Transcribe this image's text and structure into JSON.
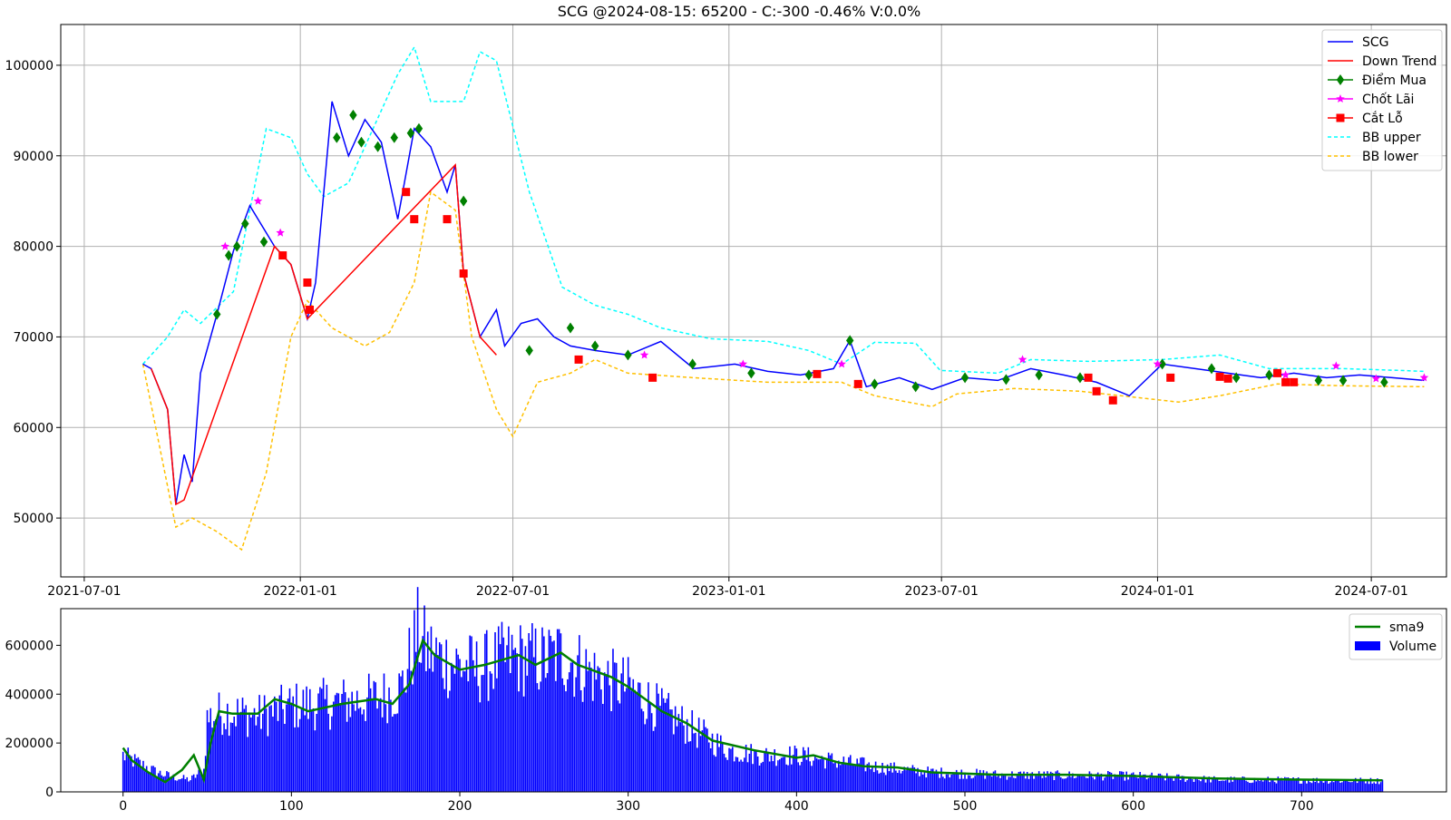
{
  "chart_data": [
    {
      "type": "line",
      "title": "SCG @2024-08-15: 65200 - C:-300 -0.46% V:0.0%",
      "xlabel": "",
      "ylabel": "",
      "x_tick_labels": [
        "2021-07-01",
        "2022-01-01",
        "2022-07-01",
        "2023-01-01",
        "2023-07-01",
        "2024-01-01",
        "2024-07-01"
      ],
      "y_tick_labels": [
        "50000",
        "60000",
        "70000",
        "80000",
        "90000",
        "100000"
      ],
      "ylim": [
        43500,
        104500
      ],
      "xlim": [
        "2021-06-11",
        "2024-09-03"
      ],
      "grid": true,
      "legend_position": "top-right",
      "legend": [
        "SCG",
        "Down Trend",
        "Điểm Mua",
        "Chốt Lãi",
        "Cắt Lỗ",
        "BB upper",
        "BB lower"
      ],
      "colors": {
        "price": "#0000ff",
        "down": "#ff0000",
        "buy": "#008000",
        "take_profit": "#ff00ff",
        "stop_loss": "#ff0000",
        "bb_upper": "#00ffff",
        "bb_lower": "#ffc000"
      },
      "series": [
        {
          "name": "SCG",
          "x": [
            "2021-08-20",
            "2021-08-27",
            "2021-09-10",
            "2021-09-17",
            "2021-09-24",
            "2021-10-01",
            "2021-10-08",
            "2021-10-22",
            "2021-11-05",
            "2021-11-19",
            "2021-11-26",
            "2021-12-10",
            "2021-12-24",
            "2022-01-07",
            "2022-01-14",
            "2022-01-28",
            "2022-02-11",
            "2022-02-25",
            "2022-03-11",
            "2022-03-25",
            "2022-04-08",
            "2022-04-22",
            "2022-05-06",
            "2022-05-13",
            "2022-05-20",
            "2022-06-03",
            "2022-06-17",
            "2022-06-24",
            "2022-07-08",
            "2022-07-22",
            "2022-08-05",
            "2022-08-19",
            "2022-09-09",
            "2022-10-07",
            "2022-11-04",
            "2022-12-02",
            "2023-01-06",
            "2023-02-03",
            "2023-03-03",
            "2023-03-31",
            "2023-04-14",
            "2023-04-28",
            "2023-05-26",
            "2023-06-23",
            "2023-07-21",
            "2023-08-18",
            "2023-09-15",
            "2023-10-13",
            "2023-11-10",
            "2023-12-08",
            "2024-01-05",
            "2024-02-02",
            "2024-03-01",
            "2024-03-29",
            "2024-04-26",
            "2024-05-24",
            "2024-06-21",
            "2024-07-19",
            "2024-08-15"
          ],
          "values": [
            67000,
            66500,
            62000,
            51500,
            57000,
            54000,
            66000,
            72500,
            79500,
            84500,
            83000,
            80000,
            78000,
            72000,
            76000,
            96000,
            90000,
            94000,
            91500,
            83000,
            93000,
            91000,
            86000,
            89000,
            77000,
            70000,
            73000,
            69000,
            71500,
            72000,
            70000,
            69000,
            68500,
            68000,
            69500,
            66500,
            67000,
            66200,
            65800,
            66500,
            69600,
            64500,
            65500,
            64200,
            65500,
            65200,
            66500,
            65800,
            65000,
            63500,
            67000,
            66500,
            66000,
            65500,
            66000,
            65500,
            65800,
            65500,
            65200
          ]
        },
        {
          "name": "Down Trend",
          "x": [
            "2021-08-27",
            "2021-09-10",
            "2021-09-17",
            "2021-09-24",
            "2021-12-10",
            "2021-12-24",
            "2022-01-07",
            "2022-05-13",
            "2022-05-20",
            "2022-06-03",
            "2022-06-17"
          ],
          "values": [
            66500,
            62000,
            51500,
            52000,
            80000,
            78000,
            72000,
            89000,
            77000,
            70000,
            68000
          ]
        },
        {
          "name": "Điểm Mua",
          "x": [
            "2021-10-22",
            "2021-11-01",
            "2021-11-08",
            "2021-11-15",
            "2021-12-01",
            "2022-02-01",
            "2022-02-15",
            "2022-02-22",
            "2022-03-08",
            "2022-03-22",
            "2022-04-05",
            "2022-04-12",
            "2022-05-20",
            "2022-07-15",
            "2022-08-19",
            "2022-09-09",
            "2022-10-07",
            "2022-12-01",
            "2023-01-20",
            "2023-03-10",
            "2023-04-14",
            "2023-05-05",
            "2023-06-09",
            "2023-07-21",
            "2023-08-25",
            "2023-09-22",
            "2023-10-27",
            "2024-01-05",
            "2024-02-16",
            "2024-03-08",
            "2024-04-05",
            "2024-05-17",
            "2024-06-07",
            "2024-07-12"
          ],
          "values": [
            72500,
            79000,
            80000,
            82500,
            80500,
            92000,
            94500,
            91500,
            91000,
            92000,
            92500,
            93000,
            85000,
            68500,
            71000,
            69000,
            68000,
            67000,
            66000,
            65800,
            69600,
            64800,
            64500,
            65500,
            65300,
            65800,
            65500,
            67000,
            66500,
            65500,
            65800,
            65200,
            65200,
            65000
          ]
        },
        {
          "name": "Chốt Lãi",
          "x": [
            "2021-10-29",
            "2021-11-26",
            "2021-12-15",
            "2022-10-21",
            "2023-01-13",
            "2023-04-07",
            "2023-09-08",
            "2024-01-01",
            "2024-04-19",
            "2024-06-01",
            "2024-07-05",
            "2024-08-15"
          ],
          "values": [
            80000,
            85000,
            81500,
            68000,
            67000,
            67000,
            67500,
            67000,
            65800,
            66800,
            65400,
            65500
          ]
        },
        {
          "name": "Cắt Lỗ",
          "x": [
            "2021-12-17",
            "2022-01-07",
            "2022-01-09",
            "2022-04-01",
            "2022-04-08",
            "2022-05-06",
            "2022-05-20",
            "2022-08-26",
            "2022-10-28",
            "2023-03-17",
            "2023-04-21",
            "2023-11-03",
            "2023-11-10",
            "2023-11-24",
            "2024-01-12",
            "2024-02-23",
            "2024-03-01",
            "2024-04-12",
            "2024-04-19",
            "2024-04-26"
          ],
          "values": [
            79000,
            76000,
            73000,
            86000,
            83000,
            83000,
            77000,
            67500,
            65500,
            65900,
            64800,
            65500,
            64000,
            63000,
            65500,
            65600,
            65400,
            66000,
            65000,
            65000
          ]
        },
        {
          "name": "BB upper",
          "x": [
            "2021-08-20",
            "2021-09-10",
            "2021-09-24",
            "2021-10-08",
            "2021-11-05",
            "2021-11-19",
            "2021-12-03",
            "2021-12-24",
            "2022-01-07",
            "2022-01-21",
            "2022-02-11",
            "2022-03-04",
            "2022-03-25",
            "2022-04-08",
            "2022-04-22",
            "2022-05-20",
            "2022-06-03",
            "2022-06-17",
            "2022-07-15",
            "2022-08-12",
            "2022-09-09",
            "2022-10-07",
            "2022-11-04",
            "2022-12-16",
            "2023-02-03",
            "2023-03-10",
            "2023-04-07",
            "2023-05-05",
            "2023-06-09",
            "2023-06-30",
            "2023-08-18",
            "2023-09-15",
            "2023-11-03",
            "2024-01-05",
            "2024-02-23",
            "2024-04-05",
            "2024-06-07",
            "2024-07-26",
            "2024-08-15"
          ],
          "values": [
            67000,
            70000,
            73000,
            71500,
            75000,
            84000,
            93000,
            92000,
            88000,
            85500,
            87000,
            93000,
            99000,
            102000,
            96000,
            96000,
            101500,
            100500,
            86000,
            75500,
            73500,
            72500,
            71000,
            69800,
            69500,
            68500,
            67000,
            69400,
            69300,
            66300,
            66000,
            67500,
            67300,
            67500,
            68000,
            66500,
            66500,
            66300,
            66200
          ]
        },
        {
          "name": "BB lower",
          "x": [
            "2021-08-20",
            "2021-09-17",
            "2021-10-01",
            "2021-10-22",
            "2021-11-12",
            "2021-12-03",
            "2021-12-24",
            "2022-01-07",
            "2022-01-28",
            "2022-02-25",
            "2022-03-18",
            "2022-04-08",
            "2022-04-22",
            "2022-05-13",
            "2022-05-27",
            "2022-06-17",
            "2022-07-01",
            "2022-07-22",
            "2022-08-19",
            "2022-09-09",
            "2022-10-07",
            "2022-12-02",
            "2023-02-03",
            "2023-04-07",
            "2023-05-05",
            "2023-06-23",
            "2023-07-14",
            "2023-09-01",
            "2023-10-27",
            "2023-12-22",
            "2024-01-19",
            "2024-02-23",
            "2024-04-12",
            "2024-06-07",
            "2024-08-15"
          ],
          "values": [
            67000,
            49000,
            50000,
            48500,
            46500,
            55000,
            70000,
            74000,
            71000,
            69000,
            70500,
            76000,
            86000,
            84000,
            70000,
            62000,
            59000,
            65000,
            66000,
            67500,
            66000,
            65500,
            65000,
            65000,
            63500,
            62300,
            63700,
            64300,
            64000,
            63200,
            62800,
            63500,
            64800,
            64600,
            64500
          ]
        }
      ]
    },
    {
      "type": "bar",
      "title": "",
      "xlabel": "",
      "ylabel": "",
      "x_tick_labels": [
        "0",
        "100",
        "200",
        "300",
        "400",
        "500",
        "600",
        "700"
      ],
      "y_tick_labels": [
        "0",
        "200000",
        "400000",
        "600000"
      ],
      "xlim": [
        -37,
        786
      ],
      "ylim": [
        0,
        750000
      ],
      "grid": false,
      "legend_position": "top-right",
      "legend": [
        "sma9",
        "Volume"
      ],
      "colors": {
        "volume": "#0000ff",
        "sma9": "#008000"
      },
      "series": [
        {
          "name": "Volume",
          "x_range": [
            0,
            748
          ],
          "x": [
            0,
            20,
            30,
            40,
            48,
            50,
            60,
            80,
            100,
            120,
            150,
            165,
            175,
            180,
            190,
            210,
            230,
            250,
            260,
            280,
            300,
            320,
            340,
            360,
            380,
            400,
            420,
            450,
            480,
            520,
            600,
            650,
            700,
            748
          ],
          "values": [
            150000,
            80000,
            60000,
            50000,
            90000,
            300000,
            330000,
            310000,
            350000,
            360000,
            380000,
            420000,
            650000,
            580000,
            540000,
            500000,
            550000,
            540000,
            560000,
            480000,
            430000,
            330000,
            250000,
            170000,
            150000,
            150000,
            130000,
            100000,
            80000,
            70000,
            65000,
            50000,
            48000,
            45000
          ]
        },
        {
          "name": "sma9",
          "x": [
            0,
            5,
            15,
            25,
            35,
            42,
            48,
            52,
            57,
            65,
            80,
            90,
            100,
            110,
            130,
            150,
            160,
            170,
            178,
            185,
            200,
            215,
            235,
            245,
            260,
            270,
            290,
            300,
            320,
            335,
            350,
            375,
            400,
            410,
            425,
            440,
            460,
            480,
            520,
            560,
            600,
            650,
            700,
            748
          ],
          "values": [
            180000,
            130000,
            80000,
            40000,
            90000,
            150000,
            50000,
            200000,
            330000,
            320000,
            320000,
            380000,
            360000,
            330000,
            360000,
            380000,
            360000,
            440000,
            620000,
            560000,
            500000,
            520000,
            560000,
            520000,
            570000,
            520000,
            470000,
            430000,
            330000,
            280000,
            210000,
            170000,
            140000,
            150000,
            120000,
            105000,
            100000,
            80000,
            70000,
            70000,
            65000,
            55000,
            50000,
            47000
          ]
        }
      ]
    }
  ]
}
